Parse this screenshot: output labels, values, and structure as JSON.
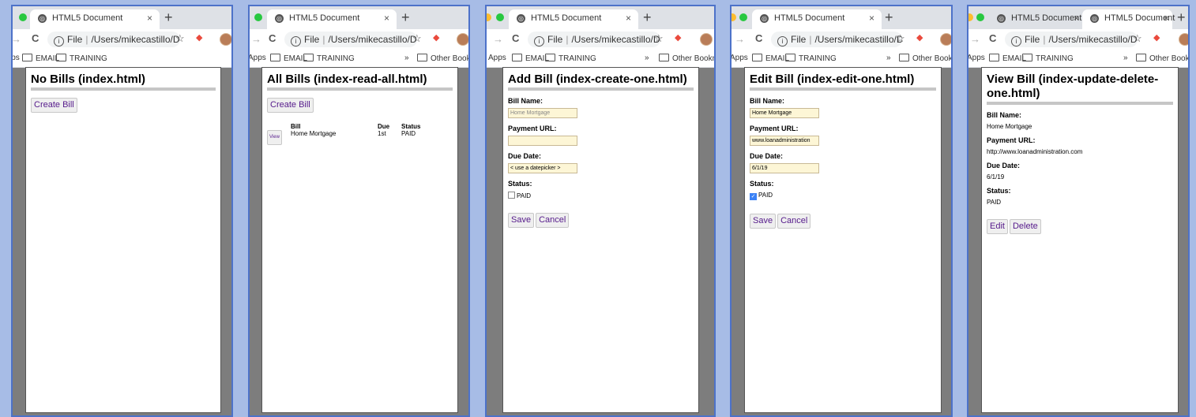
{
  "browser": {
    "tab_title": "HTML5 Document",
    "tab_close": "×",
    "new_tab": "+",
    "back": "→",
    "reload": "C",
    "info": "i",
    "omnibox_file": "File",
    "omnibox_path": "/Users/mikecastillo/D...",
    "star": "☆",
    "extension": "◆",
    "bookmarks": {
      "apps": "Apps",
      "email": "EMAIL",
      "training": "TRAINING",
      "more": "»",
      "other": "Other Bookmarks"
    },
    "colors": {
      "window_border": "#4d72c9",
      "background": "#a7bce6",
      "link": "#551a8b"
    }
  },
  "windows": [
    {
      "heading": "No Bills (index.html)",
      "create_button": "Create Bill"
    },
    {
      "heading": "All Bills (index-read-all.html)",
      "create_button": "Create Bill",
      "table": {
        "headers": [
          "",
          "Bill",
          "Due",
          "Status"
        ],
        "rows": [
          {
            "action": "View",
            "bill": "Home Mortgage",
            "due": "1st",
            "status": "PAID"
          }
        ]
      }
    },
    {
      "heading": "Add Bill (index-create-one.html)",
      "bill_name_label": "Bill Name:",
      "bill_name_value": "Home Mortgage",
      "payment_url_label": "Payment URL:",
      "payment_url_value": "",
      "due_date_label": "Due Date:",
      "due_date_value": "< use a datepicker >",
      "status_label": "Status:",
      "status_option": "PAID",
      "status_checked": false,
      "save_button": "Save",
      "cancel_button": "Cancel"
    },
    {
      "heading": "Edit Bill (index-edit-one.html)",
      "bill_name_label": "Bill Name:",
      "bill_name_value": "Home Mortgage",
      "payment_url_label": "Payment URL:",
      "payment_url_value": "www.loanadministration",
      "due_date_label": "Due Date:",
      "due_date_value": "6/1/19",
      "status_label": "Status:",
      "status_option": "PAID",
      "status_checked": true,
      "save_button": "Save",
      "cancel_button": "Cancel"
    },
    {
      "heading": "View Bill (index-update-delete-one.html)",
      "bill_name_label": "Bill Name:",
      "bill_name_value": "Home Mortgage",
      "payment_url_label": "Payment URL:",
      "payment_url_value": "http://www.loanadministration.com",
      "due_date_label": "Due Date:",
      "due_date_value": "6/1/19",
      "status_label": "Status:",
      "status_value": "PAID",
      "edit_button": "Edit",
      "delete_button": "Delete"
    }
  ]
}
